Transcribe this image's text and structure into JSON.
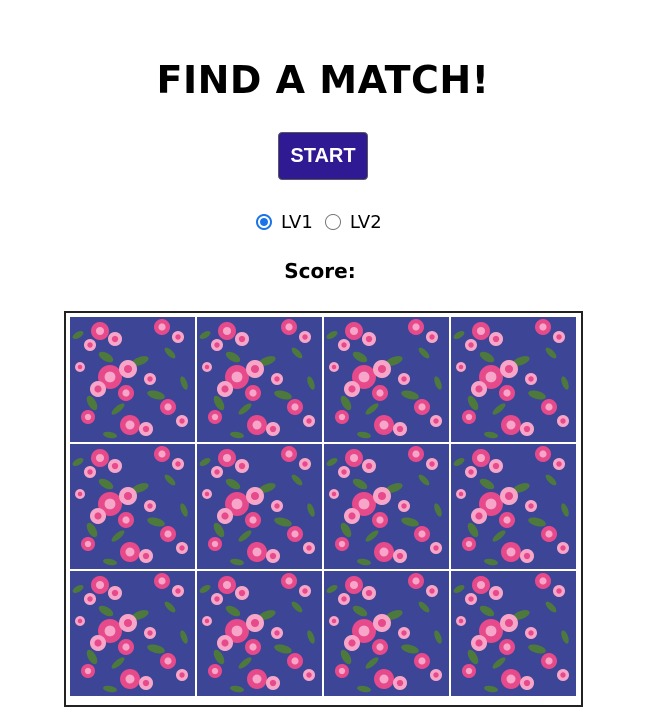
{
  "title": "FIND A MATCH!",
  "start_label": "START",
  "levels": [
    {
      "label": "LV1",
      "selected": true
    },
    {
      "label": "LV2",
      "selected": false
    }
  ],
  "score": {
    "label": "Score:",
    "value": ""
  },
  "board": {
    "rows": 3,
    "columns": 4,
    "card_back": "floral-pattern",
    "cards": [
      "hidden",
      "hidden",
      "hidden",
      "hidden",
      "hidden",
      "hidden",
      "hidden",
      "hidden",
      "hidden",
      "hidden",
      "hidden",
      "hidden"
    ]
  },
  "colors": {
    "start_button": "#301a93",
    "card_background": "#3d4596",
    "rose_pink": "#e64a8a",
    "rose_light": "#f7a6c9",
    "leaf": "#4d7a3c",
    "radio_accent": "#1a73e8"
  }
}
